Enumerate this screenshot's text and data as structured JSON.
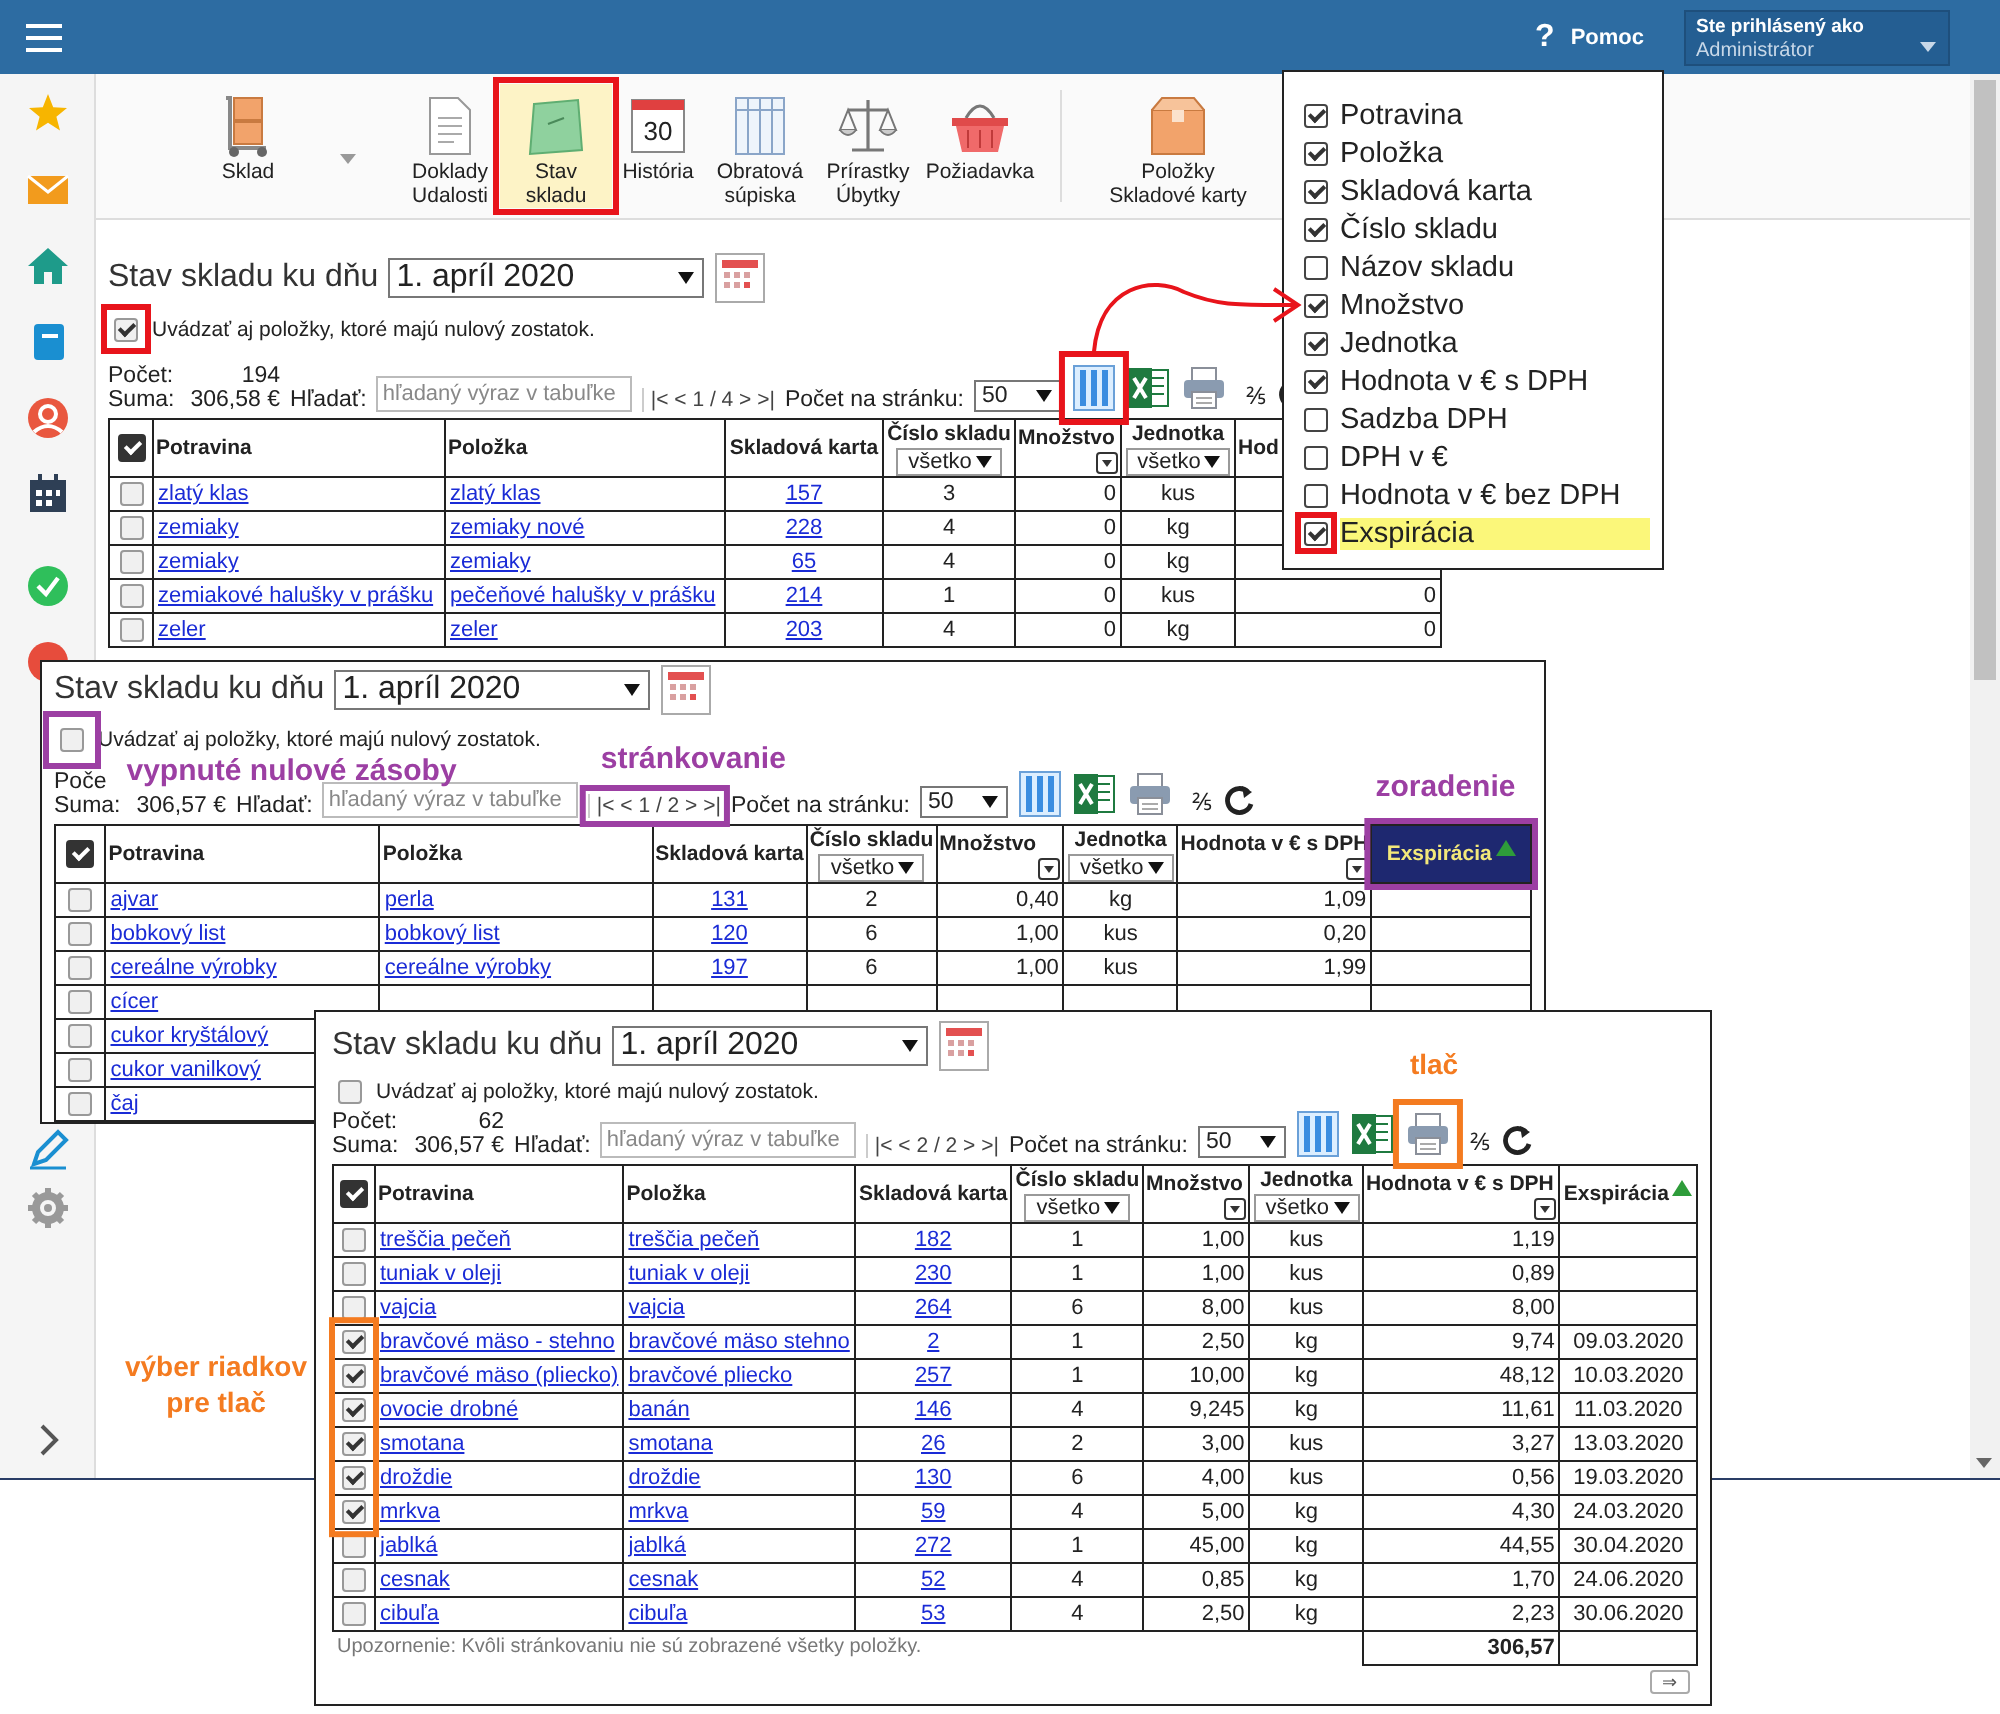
{
  "header": {
    "help_icon": "?",
    "help_label": "Pomoc",
    "user_caption": "Ste prihlásený ako",
    "user_role": "Administrátor"
  },
  "toolbar": [
    {
      "label": "Sklad",
      "selected": false
    },
    {
      "label": "Doklady\nUdalosti",
      "selected": false
    },
    {
      "label": "Stav\nskladu",
      "selected": true
    },
    {
      "label": "História",
      "icon_text": "30",
      "selected": false
    },
    {
      "label": "Obratová\nsúpiska",
      "selected": false
    },
    {
      "label": "Prírastky\nÚbytky",
      "selected": false
    },
    {
      "label": "Požiadavka",
      "selected": false
    },
    {
      "label": "Položky\nSkladové karty",
      "selected": false
    }
  ],
  "panels": [
    {
      "title": "Stav skladu ku dňu",
      "date": "1. apríl 2020",
      "show_zero": {
        "label": "Uvádzať aj položky, ktoré majú nulový zostatok.",
        "checked": true
      },
      "count_label": "Počet:",
      "count": "194",
      "sum_label": "Suma:",
      "sum": "306,58 €",
      "search_label": "Hľadať:",
      "search_placeholder": "hľadaný výraz v tabuľke",
      "pager": "|< < 1 / 4 > >|",
      "page_size_label": "Počet na stránku:",
      "page_size": "50",
      "fraction": "⅖",
      "select_all": true,
      "columns": [
        {
          "label": "Potravina",
          "kind": "link"
        },
        {
          "label": "Položka",
          "kind": "link"
        },
        {
          "label": "Skladová karta",
          "kind": "link_center"
        },
        {
          "label": "Číslo skladu",
          "kind": "center",
          "filter": {
            "kind": "select",
            "value": "všetko"
          }
        },
        {
          "label": "Množstvo",
          "kind": "number",
          "filter": {
            "kind": "icon"
          }
        },
        {
          "label": "Jednotka",
          "kind": "center",
          "filter": {
            "kind": "select",
            "value": "všetko"
          }
        },
        {
          "label": "Hod",
          "kind": "number"
        }
      ],
      "rows": [
        {
          "selected": false,
          "cells": [
            "zlatý klas",
            "zlatý klas",
            "157",
            "3",
            "0",
            "kus"
          ]
        },
        {
          "selected": false,
          "cells": [
            "zemiaky",
            "zemiaky nové",
            "228",
            "4",
            "0",
            "kg"
          ]
        },
        {
          "selected": false,
          "cells": [
            "zemiaky",
            "zemiaky",
            "65",
            "4",
            "0",
            "kg"
          ]
        },
        {
          "selected": false,
          "cells": [
            "zemiakové halušky v prášku",
            "pečeňové halušky v prášku",
            "214",
            "1",
            "0",
            "kus",
            "0"
          ]
        },
        {
          "selected": false,
          "cells": [
            "zeler",
            "zeler",
            "203",
            "4",
            "0",
            "kg",
            "0"
          ]
        }
      ]
    },
    {
      "title": "Stav skladu ku dňu",
      "date": "1. apríl 2020",
      "show_zero": {
        "label": "Uvádzať aj položky, ktoré majú nulový zostatok.",
        "checked": false
      },
      "count_label": "Poče",
      "sum_label": "Suma:",
      "sum": "306,57 €",
      "search_label": "Hľadať:",
      "search_placeholder": "hľadaný výraz v tabuľke",
      "pager": "|< < 1 / 2 > >|",
      "page_size_label": "Počet na stránku:",
      "page_size": "50",
      "fraction": "⅖",
      "select_all": true,
      "columns": [
        {
          "label": "Potravina",
          "kind": "link"
        },
        {
          "label": "Položka",
          "kind": "link"
        },
        {
          "label": "Skladová karta",
          "kind": "link_center"
        },
        {
          "label": "Číslo skladu",
          "kind": "center",
          "filter": {
            "kind": "select",
            "value": "všetko"
          }
        },
        {
          "label": "Množstvo",
          "kind": "number",
          "filter": {
            "kind": "icon"
          }
        },
        {
          "label": "Jednotka",
          "kind": "center",
          "filter": {
            "kind": "select",
            "value": "všetko"
          }
        },
        {
          "label": "Hodnota v € s DPH",
          "kind": "number",
          "filter": {
            "kind": "icon"
          }
        },
        {
          "label": "Exspirácia",
          "kind": "center",
          "sorted": true,
          "highlighted": true
        }
      ],
      "rows": [
        {
          "selected": false,
          "cells": [
            "ajvar",
            "perla",
            "131",
            "2",
            "0,40",
            "kg",
            "1,09"
          ]
        },
        {
          "selected": false,
          "cells": [
            "bobkový list",
            "bobkový list",
            "120",
            "6",
            "1,00",
            "kus",
            "0,20"
          ]
        },
        {
          "selected": false,
          "cells": [
            "cereálne výrobky",
            "cereálne výrobky",
            "197",
            "6",
            "1,00",
            "kus",
            "1,99"
          ]
        },
        {
          "selected": false,
          "cells": [
            "cícer"
          ]
        },
        {
          "selected": false,
          "cells": [
            "cukor kryštálový"
          ]
        },
        {
          "selected": false,
          "cells": [
            "cukor vanilkový"
          ]
        },
        {
          "selected": false,
          "cells": [
            "čaj"
          ]
        }
      ]
    },
    {
      "title": "Stav skladu ku dňu",
      "date": "1. apríl 2020",
      "show_zero": {
        "label": "Uvádzať aj položky, ktoré majú nulový zostatok.",
        "checked": false
      },
      "count_label": "Počet:",
      "count": "62",
      "sum_label": "Suma:",
      "sum": "306,57 €",
      "search_label": "Hľadať:",
      "search_placeholder": "hľadaný výraz v tabuľke",
      "pager": "|< < 2 / 2 > >|",
      "page_size_label": "Počet na stránku:",
      "page_size": "50",
      "fraction": "⅖",
      "select_all": true,
      "columns": [
        {
          "label": "Potravina",
          "kind": "link"
        },
        {
          "label": "Položka",
          "kind": "link"
        },
        {
          "label": "Skladová karta",
          "kind": "link_center"
        },
        {
          "label": "Číslo skladu",
          "kind": "center",
          "filter": {
            "kind": "select",
            "value": "všetko"
          }
        },
        {
          "label": "Množstvo",
          "kind": "number",
          "filter": {
            "kind": "icon"
          }
        },
        {
          "label": "Jednotka",
          "kind": "center",
          "filter": {
            "kind": "select",
            "value": "všetko"
          }
        },
        {
          "label": "Hodnota v € s DPH",
          "kind": "number",
          "filter": {
            "kind": "icon"
          }
        },
        {
          "label": "Exspirácia",
          "kind": "center",
          "sorted": true,
          "highlighted": false
        }
      ],
      "rows": [
        {
          "selected": false,
          "cells": [
            "treščia pečeň",
            "treščia pečeň",
            "182",
            "1",
            "1,00",
            "kus",
            "1,19"
          ]
        },
        {
          "selected": false,
          "cells": [
            "tuniak v oleji",
            "tuniak v oleji",
            "230",
            "1",
            "1,00",
            "kus",
            "0,89"
          ]
        },
        {
          "selected": false,
          "cells": [
            "vajcia",
            "vajcia",
            "264",
            "6",
            "8,00",
            "kus",
            "8,00"
          ]
        },
        {
          "selected": true,
          "cells": [
            "bravčové mäso - stehno",
            "bravčové mäso stehno",
            "2",
            "1",
            "2,50",
            "kg",
            "9,74",
            "09.03.2020"
          ]
        },
        {
          "selected": true,
          "cells": [
            "bravčové mäso (pliecko)",
            "bravčové pliecko",
            "257",
            "1",
            "10,00",
            "kg",
            "48,12",
            "10.03.2020"
          ]
        },
        {
          "selected": true,
          "cells": [
            "ovocie drobné",
            "banán",
            "146",
            "4",
            "9,245",
            "kg",
            "11,61",
            "11.03.2020"
          ]
        },
        {
          "selected": true,
          "cells": [
            "smotana",
            "smotana",
            "26",
            "2",
            "3,00",
            "kus",
            "3,27",
            "13.03.2020"
          ]
        },
        {
          "selected": true,
          "cells": [
            "droždie",
            "droždie",
            "130",
            "6",
            "4,00",
            "kus",
            "0,56",
            "19.03.2020"
          ]
        },
        {
          "selected": true,
          "cells": [
            "mrkva",
            "mrkva",
            "59",
            "4",
            "5,00",
            "kg",
            "4,30",
            "24.03.2020"
          ]
        },
        {
          "selected": false,
          "cells": [
            "jablká",
            "jablká",
            "272",
            "1",
            "45,00",
            "kg",
            "44,55",
            "30.04.2020"
          ]
        },
        {
          "selected": false,
          "cells": [
            "cesnak",
            "cesnak",
            "52",
            "4",
            "0,85",
            "kg",
            "1,70",
            "24.06.2020"
          ]
        },
        {
          "selected": false,
          "cells": [
            "cibuľa",
            "cibuľa",
            "53",
            "4",
            "2,50",
            "kg",
            "2,23",
            "30.06.2020"
          ]
        }
      ],
      "note": "Upozornenie: Kvôli stránkovaniu nie sú zobrazené všetky položky.",
      "total": "306,57",
      "next_button": "⇒"
    }
  ],
  "column_picker": {
    "items": [
      {
        "label": "Potravina",
        "checked": true,
        "highlighted": false
      },
      {
        "label": "Položka",
        "checked": true,
        "highlighted": false
      },
      {
        "label": "Skladová karta",
        "checked": true,
        "highlighted": false
      },
      {
        "label": "Číslo skladu",
        "checked": true,
        "highlighted": false
      },
      {
        "label": "Názov skladu",
        "checked": false,
        "highlighted": false
      },
      {
        "label": "Množstvo",
        "checked": true,
        "highlighted": false
      },
      {
        "label": "Jednotka",
        "checked": true,
        "highlighted": false
      },
      {
        "label": "Hodnota v € s DPH",
        "checked": true,
        "highlighted": false
      },
      {
        "label": "Sadzba DPH",
        "checked": false,
        "highlighted": false
      },
      {
        "label": "DPH v €",
        "checked": false,
        "highlighted": false
      },
      {
        "label": "Hodnota v € bez DPH",
        "checked": false,
        "highlighted": false
      },
      {
        "label": "Exspirácia",
        "checked": true,
        "highlighted": true
      }
    ]
  },
  "annotations": [
    {
      "text": "vypnuté nulové zásoby",
      "color": "#9c3fa3"
    },
    {
      "text": "stránkovanie",
      "color": "#9c3fa3"
    },
    {
      "text": "zoradenie",
      "color": "#9c3fa3"
    },
    {
      "text": "tlač",
      "color": "#f47b20"
    },
    {
      "text": "výber riadkov pre tlač",
      "color": "#f47b20"
    }
  ]
}
